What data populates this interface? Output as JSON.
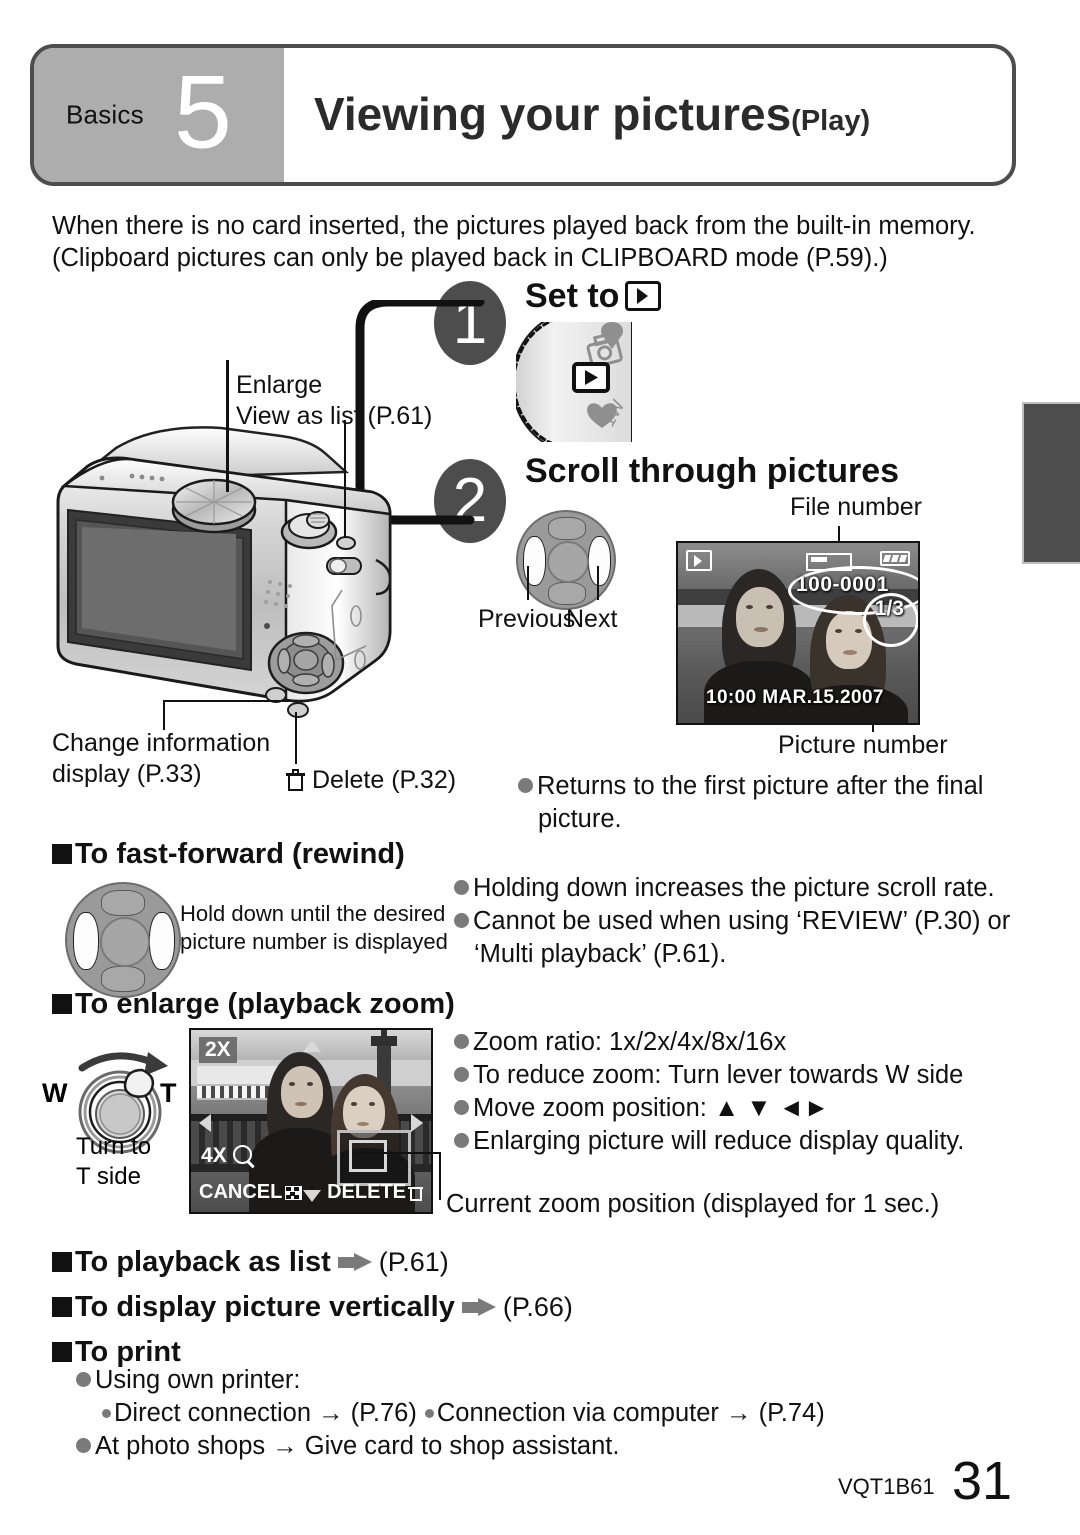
{
  "header": {
    "category": "Basics",
    "number": "5",
    "title": "Viewing your pictures",
    "subtitle": "(Play)"
  },
  "intro": {
    "line1": "When there is no card inserted, the pictures played back from the built-in memory.",
    "line2": "(Clipboard pictures can only be played back in CLIPBOARD mode (P.59).)"
  },
  "steps": [
    {
      "number": "1",
      "heading": "Set to",
      "icon": "play-icon"
    },
    {
      "number": "2",
      "heading": "Scroll through pictures"
    }
  ],
  "camera_callouts": {
    "enlarge": "Enlarge",
    "view_as_list": "View as list (P.61)",
    "change_info": "Change information",
    "change_info_2": "display (P.33)",
    "delete": "Delete (P.32)",
    "previous": "Previous",
    "next": "Next"
  },
  "lcd": {
    "file_number_label": "File number",
    "picture_number_label": "Picture number",
    "file_number": "100-0001",
    "picture_number": "1/3",
    "date": "10:00 MAR.15.2007"
  },
  "notes": {
    "returns": "Returns to the first picture after the final",
    "returns_2": "picture.",
    "holding": "Holding down increases the picture scroll rate.",
    "cannot": "Cannot be used when using ‘REVIEW’ (P.30) or",
    "cannot_2": "‘Multi playback’ (P.61)."
  },
  "fast_forward": {
    "heading": "To fast-forward (rewind)",
    "hint_1": "Hold down until the desired",
    "hint_2": "picture number is displayed"
  },
  "playback_zoom": {
    "heading": "To enlarge (playback zoom)",
    "lever_w": "W",
    "lever_t": "T",
    "turn_1": "Turn to",
    "turn_2": "T side",
    "screen": {
      "zoom_badge": "2X",
      "next_zoom": "4X",
      "cancel": "CANCEL",
      "delete": "DELETE"
    },
    "bullets": [
      "Zoom ratio: 1x/2x/4x/8x/16x",
      "To reduce zoom: Turn lever towards W side",
      "Move zoom position:  ▲ ▼ ◄►",
      "Enlarging picture will reduce display quality."
    ],
    "current_zoom_caption": "Current zoom position (displayed for 1 sec.)"
  },
  "sections": {
    "playback_as_list": "To playback as list",
    "playback_as_list_page": "(P.61)",
    "display_vertically": "To display picture vertically",
    "display_vertically_page": "(P.66)",
    "to_print": "To print",
    "print_bullets": {
      "own_printer": "Using own printer:",
      "direct": "Direct connection → (P.76)",
      "computer": "Connection via computer → (P.74)",
      "photo_shops": "At photo shops → Give card to shop assistant."
    }
  },
  "footer": {
    "code": "VQT1B61",
    "page": "31"
  },
  "colors": {
    "header_gray": "#adadad",
    "step_badge": "#4d4d4d",
    "bullet_gray": "#7a7a7a",
    "side_tab": "#4d4d4d"
  }
}
